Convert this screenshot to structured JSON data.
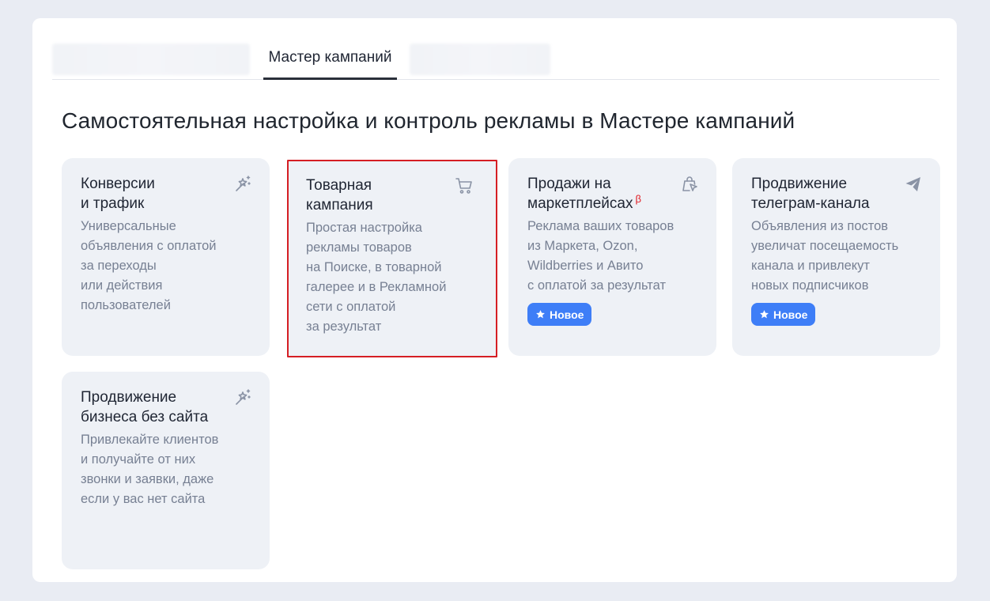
{
  "tabs": {
    "active_label": "Мастер кампаний"
  },
  "heading": "Самостоятельная настройка и контроль рекламы в Мастере кампаний",
  "cards": [
    {
      "title": "Конверсии\nи трафик",
      "description": "Универсальные\nобъявления с оплатой\nза переходы\nили действия\nпользователей",
      "icon": "magic-wand-icon"
    },
    {
      "title": "Товарная\nкампания",
      "description": "Простая настройка\nрекламы товаров\nна Поиске, в товарной\nгалерее и в Рекламной\nсети с оплатой\nза результат",
      "icon": "shopping-cart-icon"
    },
    {
      "title": "Продажи на\nмаркетплейсах",
      "beta": "β",
      "description": "Реклама ваших товаров\nиз Маркета, Ozon,\nWildberries и Авито\nс оплатой за результат",
      "badge": "Новое",
      "icon": "shopping-bag-cursor-icon"
    },
    {
      "title": "Продвижение\nтелеграм-канала",
      "description": "Объявления из постов\nувеличат посещаемость\nканала и привлекут\nновых подписчиков",
      "badge": "Новое",
      "icon": "paper-plane-icon"
    },
    {
      "title": "Продвижение\nбизнеса без сайта",
      "description": "Привлекайте клиентов\nи получайте от них\nзвонки и заявки, даже\nесли у вас нет сайта",
      "icon": "magic-wand-icon"
    }
  ],
  "colors": {
    "accent_badge": "#3e7ef7",
    "highlight_border": "#d51e24",
    "card_bg": "#eef1f6",
    "page_bg": "#e9ecf3"
  }
}
